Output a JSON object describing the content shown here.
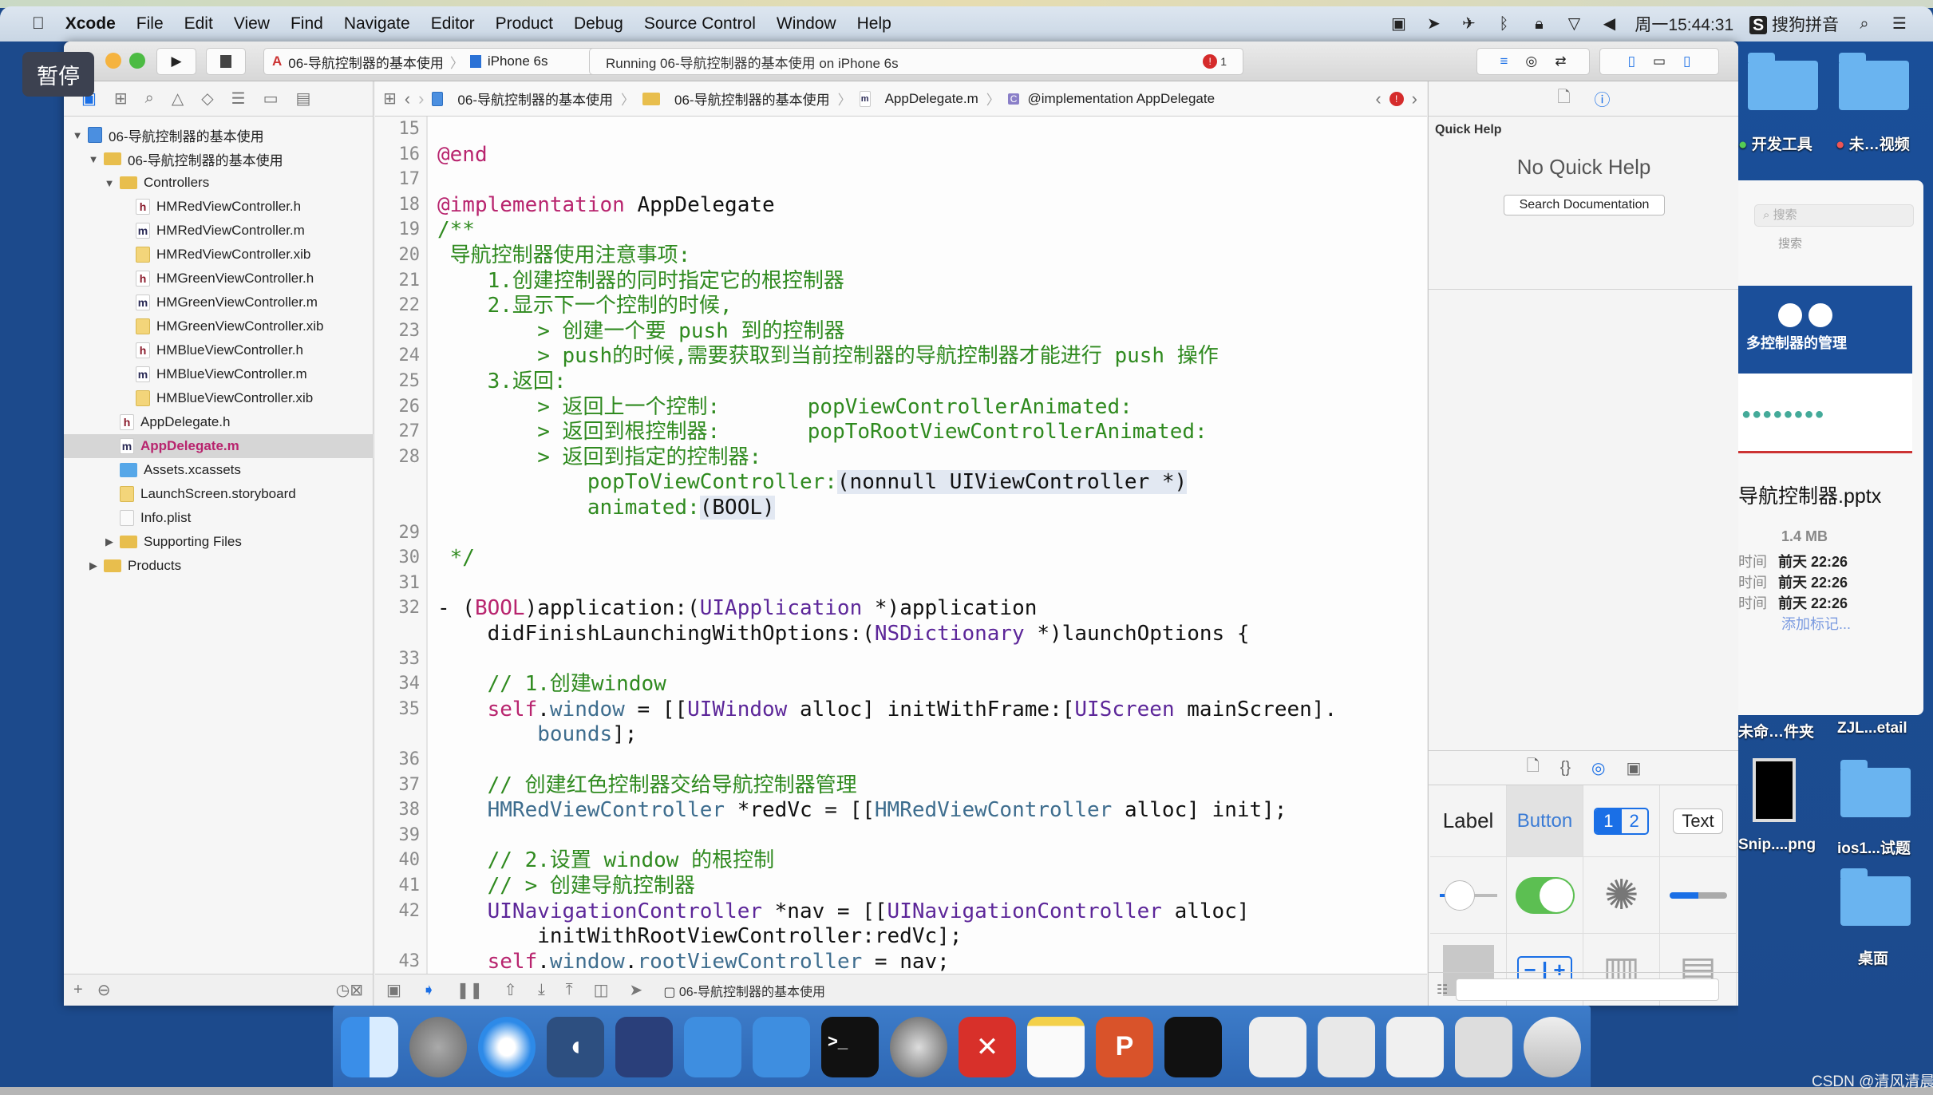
{
  "menubar": {
    "app": "Xcode",
    "items": [
      "File",
      "Edit",
      "View",
      "Find",
      "Navigate",
      "Editor",
      "Product",
      "Debug",
      "Source Control",
      "Window",
      "Help"
    ],
    "clock": "周一15:44:31",
    "input_method": "搜狗拼音"
  },
  "overlay": {
    "pause_label": "暂停"
  },
  "toolbar": {
    "scheme": "06-导航控制器的基本使用",
    "device": "iPhone 6s",
    "status": "Running 06-导航控制器的基本使用 on iPhone 6s",
    "error_count": "1"
  },
  "jumpbar": {
    "crumbs": [
      "06-导航控制器的基本使用",
      "06-导航控制器的基本使用",
      "AppDelegate.m",
      "@implementation AppDelegate"
    ]
  },
  "navigator": {
    "items": [
      {
        "label": "06-导航控制器的基本使用",
        "depth": 0,
        "disc": "open",
        "icon": "project"
      },
      {
        "label": "06-导航控制器的基本使用",
        "depth": 1,
        "disc": "open",
        "icon": "folder"
      },
      {
        "label": "Controllers",
        "depth": 2,
        "disc": "open",
        "icon": "folder"
      },
      {
        "label": "HMRedViewController.h",
        "depth": 3,
        "icon": "h"
      },
      {
        "label": "HMRedViewController.m",
        "depth": 3,
        "icon": "m"
      },
      {
        "label": "HMRedViewController.xib",
        "depth": 3,
        "icon": "xib"
      },
      {
        "label": "HMGreenViewController.h",
        "depth": 3,
        "icon": "h"
      },
      {
        "label": "HMGreenViewController.m",
        "depth": 3,
        "icon": "m"
      },
      {
        "label": "HMGreenViewController.xib",
        "depth": 3,
        "icon": "xib"
      },
      {
        "label": "HMBlueViewController.h",
        "depth": 3,
        "icon": "h"
      },
      {
        "label": "HMBlueViewController.m",
        "depth": 3,
        "icon": "m"
      },
      {
        "label": "HMBlueViewController.xib",
        "depth": 3,
        "icon": "xib"
      },
      {
        "label": "AppDelegate.h",
        "depth": 2,
        "icon": "h"
      },
      {
        "label": "AppDelegate.m",
        "depth": 2,
        "icon": "m",
        "selected": true
      },
      {
        "label": "Assets.xcassets",
        "depth": 2,
        "icon": "assets"
      },
      {
        "label": "LaunchScreen.storyboard",
        "depth": 2,
        "icon": "xib"
      },
      {
        "label": "Info.plist",
        "depth": 2,
        "icon": "plist"
      },
      {
        "label": "Supporting Files",
        "depth": 2,
        "disc": "closed",
        "icon": "folder"
      },
      {
        "label": "Products",
        "depth": 1,
        "disc": "closed",
        "icon": "folder"
      }
    ]
  },
  "editor": {
    "rows": [
      {
        "n": "15",
        "s": []
      },
      {
        "n": "16",
        "s": [
          [
            "@end",
            "kw"
          ]
        ]
      },
      {
        "n": "17",
        "s": []
      },
      {
        "n": "18",
        "s": [
          [
            "@implementation",
            "kw"
          ],
          [
            " AppDelegate",
            "pl"
          ]
        ]
      },
      {
        "n": "19",
        "s": [
          [
            "/**",
            "cm"
          ]
        ]
      },
      {
        "n": "20",
        "s": [
          [
            " 导航控制器使用注意事项:",
            "cm"
          ]
        ]
      },
      {
        "n": "21",
        "s": [
          [
            "    1.创建控制器的同时指定它的根控制器",
            "cm"
          ]
        ]
      },
      {
        "n": "22",
        "s": [
          [
            "    2.显示下一个控制的时候,",
            "cm"
          ]
        ]
      },
      {
        "n": "23",
        "s": [
          [
            "        > 创建一个要 push 到的控制器",
            "cm"
          ]
        ]
      },
      {
        "n": "24",
        "s": [
          [
            "        > push的时候,需要获取到当前控制器的导航控制器才能进行 push 操作",
            "cm"
          ]
        ]
      },
      {
        "n": "25",
        "s": [
          [
            "    3.返回:",
            "cm"
          ]
        ]
      },
      {
        "n": "26",
        "s": [
          [
            "        > 返回上一个控制:       popViewControllerAnimated:",
            "cm"
          ]
        ]
      },
      {
        "n": "27",
        "s": [
          [
            "        > 返回到根控制器:       popToRootViewControllerAnimated:",
            "cm"
          ]
        ]
      },
      {
        "n": "28",
        "s": [
          [
            "        > 返回到指定的控制器:",
            "cm"
          ]
        ]
      },
      {
        "n": "",
        "s": [
          [
            "            popToViewController:",
            "cm"
          ],
          [
            "(nonnull UIViewController *)",
            "hl"
          ]
        ]
      },
      {
        "n": "",
        "s": [
          [
            "            animated:",
            "cm"
          ],
          [
            "(BOOL)",
            "hl"
          ]
        ]
      },
      {
        "n": "29",
        "s": []
      },
      {
        "n": "30",
        "s": [
          [
            " */",
            "cm"
          ]
        ]
      },
      {
        "n": "31",
        "s": []
      },
      {
        "n": "32",
        "s": [
          [
            "- (",
            "pl"
          ],
          [
            "BOOL",
            "kw"
          ],
          [
            ")application:(",
            "pl"
          ],
          [
            "UIApplication",
            "cls"
          ],
          [
            " *)application",
            "pl"
          ]
        ]
      },
      {
        "n": "",
        "s": [
          [
            "    didFinishLaunchingWithOptions:(",
            "pl"
          ],
          [
            "NSDictionary",
            "cls"
          ],
          [
            " *)launchOptions {",
            "pl"
          ]
        ]
      },
      {
        "n": "33",
        "s": []
      },
      {
        "n": "34",
        "s": [
          [
            "    // 1.创建window",
            "cm"
          ]
        ]
      },
      {
        "n": "35",
        "s": [
          [
            "    ",
            "pl"
          ],
          [
            "self",
            "kw"
          ],
          [
            ".",
            "pl"
          ],
          [
            "window",
            "prop"
          ],
          [
            " = [[",
            "pl"
          ],
          [
            "UIWindow",
            "cls"
          ],
          [
            " alloc] initWithFrame:[",
            "pl"
          ],
          [
            "UIScreen",
            "cls"
          ],
          [
            " mainScreen].",
            "pl"
          ]
        ]
      },
      {
        "n": "",
        "s": [
          [
            "        bounds",
            "prop"
          ],
          [
            "];",
            "pl"
          ]
        ]
      },
      {
        "n": "36",
        "s": []
      },
      {
        "n": "37",
        "s": [
          [
            "    // 创建红色控制器交给导航控制器管理",
            "cm"
          ]
        ]
      },
      {
        "n": "38",
        "s": [
          [
            "    ",
            "pl"
          ],
          [
            "HMRedViewController",
            "prop"
          ],
          [
            " *redVc = [[",
            "pl"
          ],
          [
            "HMRedViewController",
            "prop"
          ],
          [
            " alloc] init];",
            "pl"
          ]
        ]
      },
      {
        "n": "39",
        "s": []
      },
      {
        "n": "40",
        "s": [
          [
            "    // 2.设置 window 的根控制",
            "cm"
          ]
        ]
      },
      {
        "n": "41",
        "s": [
          [
            "    // > 创建导航控制器",
            "cm"
          ]
        ]
      },
      {
        "n": "42",
        "s": [
          [
            "    ",
            "pl"
          ],
          [
            "UINavigationController",
            "cls"
          ],
          [
            " *nav = [[",
            "pl"
          ],
          [
            "UINavigationController",
            "cls"
          ],
          [
            " alloc]",
            "pl"
          ]
        ]
      },
      {
        "n": "",
        "s": [
          [
            "        initWithRootViewController:redVc];",
            "pl"
          ]
        ]
      },
      {
        "n": "43",
        "s": [
          [
            "    ",
            "pl"
          ],
          [
            "self",
            "kw"
          ],
          [
            ".",
            "pl"
          ],
          [
            "window",
            "prop"
          ],
          [
            ".",
            "pl"
          ],
          [
            "rootViewController",
            "prop"
          ],
          [
            " = nav;",
            "pl"
          ]
        ]
      }
    ]
  },
  "debugbar": {
    "target": "06-导航控制器的基本使用"
  },
  "inspector": {
    "title": "Quick Help",
    "empty": "No Quick Help",
    "search_button": "Search Documentation"
  },
  "library": {
    "label": "Label",
    "button": "Button",
    "seg1": "1",
    "seg2": "2",
    "text": "Text",
    "switch_on": true,
    "progress": 0.5,
    "slider": 0.2
  },
  "desktop": {
    "top_labels": [
      "开发工具",
      "未…视频"
    ],
    "search_placeholder": "搜索",
    "search_label": "搜索",
    "preview_title": "多控制器的管理",
    "file_name": "导航控制器.pptx",
    "file_size": "1.4 MB",
    "info": [
      {
        "k": "时间",
        "v": "前天 22:26"
      },
      {
        "k": "时间",
        "v": "前天 22:26"
      },
      {
        "k": "时间",
        "v": "前天 22:26"
      }
    ],
    "add_tag": "添加标记...",
    "icons": [
      "未命…件夹",
      "ZJL...etail",
      "Snip....png",
      "ios1...试题",
      "桌面"
    ]
  },
  "dock": {
    "apps": [
      "finder",
      "launchpad",
      "safari",
      "mouse",
      "photo-booth",
      "xcode",
      "simulator",
      "terminal",
      "system-preferences",
      "xmind",
      "notes",
      "powerpoint",
      "console",
      "window1",
      "window2",
      "window3",
      "window4",
      "trash"
    ]
  },
  "watermark": "CSDN @清风清晨",
  "colors": {
    "keyword": "#b8246e",
    "comment": "#2f8a1f",
    "class": "#5c2699",
    "accent": "#1a6fe6",
    "switch": "#5cbf52"
  }
}
